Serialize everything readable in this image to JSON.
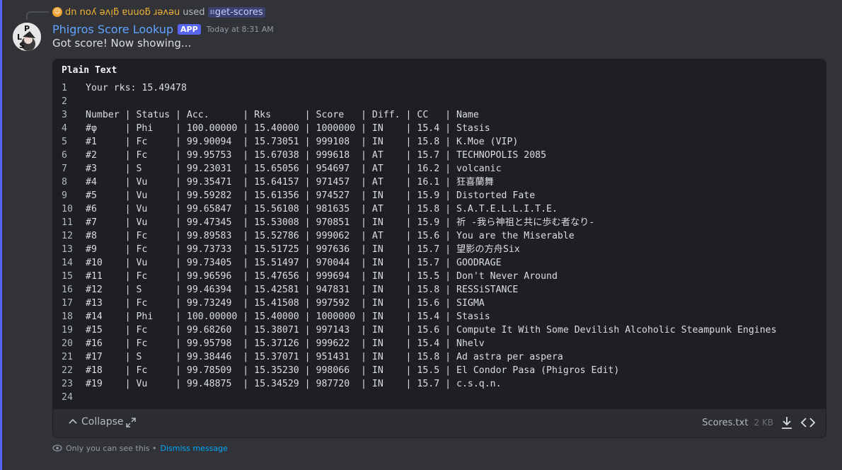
{
  "reply": {
    "username": "dn noʎ ǝʌᴉƃ ɐuuoƃ ɹǝʌǝu",
    "used_text": "used",
    "command": "get-scores"
  },
  "message": {
    "author": "Phigros Score Lookup",
    "badge": "APP",
    "timestamp": "Today at 8:31 AM",
    "text": "Got score! Now showing...",
    "avatar_letters": [
      "L",
      "P",
      "S"
    ]
  },
  "code_block": {
    "title": "Plain Text",
    "lines": [
      {
        "n": "1",
        "t": "Your rks: 15.49478"
      },
      {
        "n": "2",
        "t": ""
      },
      {
        "n": "3",
        "t": "Number | Status | Acc.      | Rks      | Score   | Diff. | CC   | Name"
      },
      {
        "n": "4",
        "t": "#φ     | Phi    | 100.00000 | 15.40000 | 1000000 | IN    | 15.4 | Stasis"
      },
      {
        "n": "5",
        "t": "#1     | Fc     | 99.90094  | 15.73051 | 999108  | IN    | 15.8 | K.Moe (VIP)"
      },
      {
        "n": "6",
        "t": "#2     | Fc     | 99.95753  | 15.67038 | 999618  | AT    | 15.7 | TECHNOPOLIS 2085"
      },
      {
        "n": "7",
        "t": "#3     | S      | 99.23031  | 15.65056 | 954697  | AT    | 16.2 | volcanic"
      },
      {
        "n": "8",
        "t": "#4     | Vu     | 99.35471  | 15.64157 | 971457  | AT    | 16.1 | 狂喜蘭舞"
      },
      {
        "n": "9",
        "t": "#5     | Vu     | 99.59282  | 15.61356 | 974527  | IN    | 15.9 | Distorted Fate"
      },
      {
        "n": "10",
        "t": "#6     | Vu     | 99.65847  | 15.56108 | 981635  | AT    | 15.8 | S.A.T.E.L.L.I.T.E."
      },
      {
        "n": "11",
        "t": "#7     | Vu     | 99.47345  | 15.53008 | 970851  | IN    | 15.9 | 祈 -我ら神祖と共に歩む者なり-"
      },
      {
        "n": "12",
        "t": "#8     | Fc     | 99.89583  | 15.52786 | 999062  | AT    | 15.6 | You are the Miserable"
      },
      {
        "n": "13",
        "t": "#9     | Fc     | 99.73733  | 15.51725 | 997636  | IN    | 15.7 | 望影の方舟Six"
      },
      {
        "n": "14",
        "t": "#10    | Vu     | 99.73405  | 15.51497 | 970044  | IN    | 15.7 | GOODRAGE"
      },
      {
        "n": "15",
        "t": "#11    | Fc     | 99.96596  | 15.47656 | 999694  | IN    | 15.5 | Don't Never Around"
      },
      {
        "n": "16",
        "t": "#12    | S      | 99.46394  | 15.42581 | 947831  | IN    | 15.8 | RESSiSTANCE"
      },
      {
        "n": "17",
        "t": "#13    | Fc     | 99.73249  | 15.41508 | 997592  | IN    | 15.6 | SIGMA"
      },
      {
        "n": "18",
        "t": "#14    | Phi    | 100.00000 | 15.40000 | 1000000 | IN    | 15.4 | Stasis"
      },
      {
        "n": "19",
        "t": "#15    | Fc     | 99.68260  | 15.38071 | 997143  | IN    | 15.6 | Compute It With Some Devilish Alcoholic Steampunk Engines"
      },
      {
        "n": "20",
        "t": "#16    | Fc     | 99.95798  | 15.37126 | 999622  | IN    | 15.4 | Nhelv"
      },
      {
        "n": "21",
        "t": "#17    | S      | 99.38446  | 15.37071 | 951431  | IN    | 15.8 | Ad astra per aspera"
      },
      {
        "n": "22",
        "t": "#18    | Fc     | 99.78509  | 15.35230 | 998066  | IN    | 15.5 | El Condor Pasa (Phigros Edit)"
      },
      {
        "n": "23",
        "t": "#19    | Vu     | 99.48875  | 15.34529 | 987720  | IN    | 15.7 | c.s.q.n."
      },
      {
        "n": "24",
        "t": ""
      }
    ]
  },
  "footer": {
    "collapse_label": "Collapse",
    "filename": "Scores.txt",
    "filesize": "2 KB"
  },
  "ephemeral": {
    "notice": "Only you can see this •",
    "dismiss_label": "Dismiss message"
  },
  "colors": {
    "accent": "#5865f2",
    "link": "#00a8fc",
    "bot_name": "#5fa3ff",
    "reply_user": "#f0b232"
  }
}
